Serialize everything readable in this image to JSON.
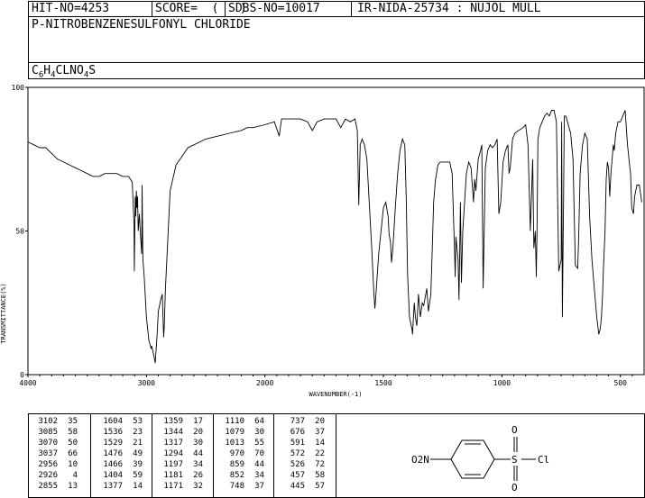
{
  "header": {
    "hit_no": "HIT-NO=4253",
    "score": "SCORE=  (   )",
    "sdbs_no": "SDBS-NO=10017",
    "ir_nida": "IR-NIDA-25734 : NUJOL MULL"
  },
  "compound": {
    "name": "P-NITROBENZENESULFONYL CHLORIDE",
    "formula_parts": [
      {
        "t": "C",
        "sub": false
      },
      {
        "t": "6",
        "sub": true
      },
      {
        "t": "H",
        "sub": false
      },
      {
        "t": "4",
        "sub": true
      },
      {
        "t": "CLNO",
        "sub": false
      },
      {
        "t": "4",
        "sub": true
      },
      {
        "t": "S",
        "sub": false
      }
    ]
  },
  "chart_data": {
    "type": "line",
    "xlabel": "WAVENUMBER(-1)",
    "ylabel": "TRANSMITTANCE(%)",
    "xlim": [
      4000,
      400
    ],
    "ylim": [
      0,
      100
    ],
    "x_ticks": [
      4000,
      3000,
      2000,
      1500,
      1000,
      500
    ],
    "y_ticks": [
      0,
      50,
      100
    ],
    "x": [
      4000,
      3950,
      3900,
      3850,
      3800,
      3750,
      3700,
      3650,
      3600,
      3550,
      3500,
      3450,
      3400,
      3350,
      3300,
      3250,
      3200,
      3150,
      3120,
      3105,
      3102,
      3095,
      3090,
      3085,
      3080,
      3075,
      3070,
      3060,
      3050,
      3040,
      3037,
      3030,
      3020,
      3000,
      2980,
      2960,
      2956,
      2945,
      2935,
      2926,
      2920,
      2910,
      2900,
      2880,
      2866,
      2855,
      2850,
      2840,
      2800,
      2750,
      2700,
      2650,
      2600,
      2550,
      2500,
      2400,
      2300,
      2200,
      2150,
      2100,
      2000,
      1960,
      1940,
      1930,
      1900,
      1850,
      1820,
      1800,
      1780,
      1750,
      1700,
      1680,
      1660,
      1640,
      1620,
      1610,
      1604,
      1598,
      1590,
      1580,
      1570,
      1560,
      1550,
      1540,
      1536,
      1530,
      1520,
      1500,
      1490,
      1480,
      1476,
      1470,
      1466,
      1460,
      1450,
      1440,
      1430,
      1420,
      1410,
      1404,
      1398,
      1390,
      1380,
      1377,
      1370,
      1365,
      1359,
      1352,
      1344,
      1336,
      1330,
      1317,
      1310,
      1300,
      1294,
      1288,
      1280,
      1270,
      1260,
      1240,
      1220,
      1210,
      1200,
      1197,
      1194,
      1185,
      1181,
      1175,
      1171,
      1165,
      1150,
      1140,
      1130,
      1120,
      1115,
      1110,
      1100,
      1090,
      1085,
      1079,
      1070,
      1060,
      1050,
      1040,
      1030,
      1020,
      1013,
      1005,
      995,
      985,
      975,
      970,
      965,
      955,
      945,
      930,
      910,
      900,
      890,
      880,
      870,
      865,
      859,
      855,
      852,
      848,
      840,
      830,
      820,
      810,
      800,
      790,
      780,
      770,
      760,
      750,
      748,
      745,
      740,
      737,
      730,
      720,
      710,
      700,
      690,
      680,
      676,
      670,
      660,
      650,
      640,
      630,
      620,
      610,
      600,
      591,
      585,
      580,
      575,
      572,
      565,
      560,
      555,
      550,
      545,
      540,
      530,
      526,
      520,
      510,
      500,
      490,
      480,
      470,
      460,
      457,
      452,
      445,
      440,
      430,
      420,
      410,
      400
    ],
    "y": [
      81,
      80,
      79,
      79,
      77,
      75,
      74,
      73,
      72,
      71,
      70,
      69,
      69,
      70,
      70,
      70,
      69,
      69,
      67,
      52,
      36,
      62,
      55,
      64,
      58,
      62,
      50,
      56,
      48,
      42,
      66,
      40,
      35,
      20,
      12,
      9,
      10,
      8,
      6,
      4,
      8,
      14,
      22,
      26,
      28,
      13,
      16,
      30,
      64,
      73,
      76,
      79,
      80,
      81,
      82,
      83,
      84,
      85,
      86,
      86,
      87,
      88,
      83,
      89,
      89,
      89,
      88,
      85,
      88,
      89,
      89,
      86,
      89,
      88,
      89,
      85,
      59,
      80,
      82,
      80,
      75,
      60,
      45,
      28,
      23,
      30,
      42,
      58,
      60,
      55,
      49,
      46,
      39,
      44,
      58,
      70,
      78,
      82,
      80,
      62,
      35,
      20,
      16,
      14,
      25,
      20,
      17,
      28,
      20,
      25,
      24,
      30,
      22,
      28,
      44,
      60,
      68,
      73,
      74,
      74,
      74,
      70,
      44,
      34,
      48,
      40,
      26,
      60,
      32,
      50,
      70,
      74,
      72,
      60,
      68,
      64,
      75,
      78,
      80,
      30,
      72,
      78,
      80,
      79,
      80,
      82,
      56,
      60,
      74,
      78,
      80,
      70,
      72,
      82,
      84,
      85,
      86,
      87,
      80,
      50,
      75,
      44,
      50,
      34,
      50,
      82,
      86,
      88,
      90,
      91,
      90,
      92,
      92,
      88,
      36,
      40,
      88,
      20,
      60,
      90,
      90,
      87,
      84,
      75,
      38,
      37,
      48,
      70,
      80,
      84,
      82,
      55,
      40,
      30,
      20,
      14,
      16,
      20,
      28,
      36,
      50,
      68,
      74,
      72,
      62,
      70,
      80,
      78,
      84,
      88,
      88,
      90,
      92,
      80,
      72,
      70,
      58,
      56,
      62,
      66,
      66,
      60
    ],
    "peaks": [
      [
        3102,
        35
      ],
      [
        3085,
        58
      ],
      [
        3070,
        50
      ],
      [
        3037,
        66
      ],
      [
        2956,
        10
      ],
      [
        2926,
        4
      ],
      [
        2855,
        13
      ],
      [
        1604,
        53
      ],
      [
        1536,
        23
      ],
      [
        1529,
        21
      ],
      [
        1476,
        49
      ],
      [
        1466,
        39
      ],
      [
        1404,
        59
      ],
      [
        1377,
        14
      ],
      [
        1359,
        17
      ],
      [
        1344,
        20
      ],
      [
        1317,
        30
      ],
      [
        1294,
        44
      ],
      [
        1197,
        34
      ],
      [
        1181,
        26
      ],
      [
        1171,
        32
      ],
      [
        1110,
        64
      ],
      [
        1079,
        30
      ],
      [
        1013,
        55
      ],
      [
        970,
        70
      ],
      [
        859,
        44
      ],
      [
        852,
        34
      ],
      [
        748,
        37
      ],
      [
        737,
        20
      ],
      [
        676,
        37
      ],
      [
        591,
        14
      ],
      [
        572,
        22
      ],
      [
        526,
        72
      ],
      [
        457,
        58
      ],
      [
        445,
        57
      ]
    ]
  },
  "structure": {
    "left_group": "O2N",
    "s_atom": "S",
    "o_atom": "O",
    "cl_atom": "Cl"
  }
}
